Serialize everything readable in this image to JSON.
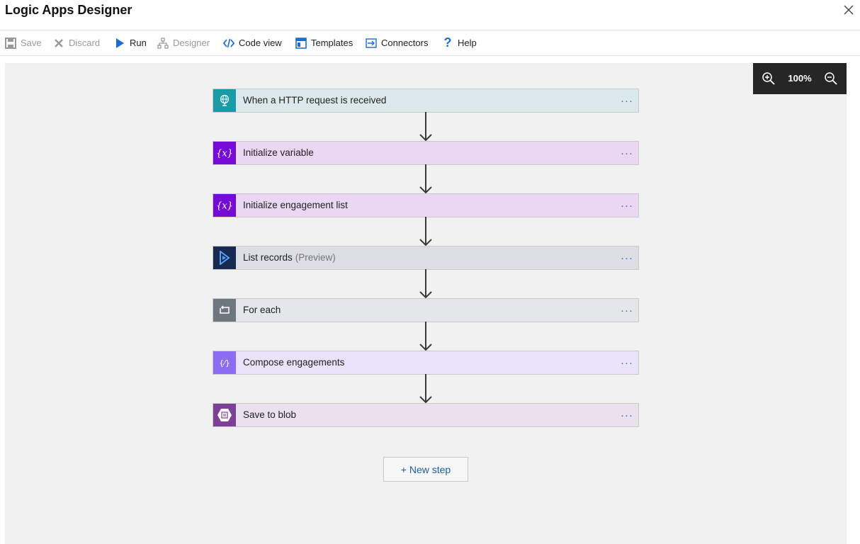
{
  "window": {
    "title": "Logic Apps Designer"
  },
  "toolbar": {
    "save": "Save",
    "discard": "Discard",
    "run": "Run",
    "designer": "Designer",
    "code_view": "Code view",
    "templates": "Templates",
    "connectors": "Connectors",
    "help": "Help"
  },
  "zoom": {
    "level": "100%"
  },
  "steps": [
    {
      "label": "When a HTTP request is received",
      "sub": "",
      "icon": "http-request-icon",
      "icon_color": "#1b9ba8",
      "bg": "#dbe9ec"
    },
    {
      "label": "Initialize variable",
      "sub": "",
      "icon": "variable-icon",
      "icon_color": "#770bd6",
      "bg": "#ead7f3"
    },
    {
      "label": "Initialize engagement list",
      "sub": "",
      "icon": "variable-icon",
      "icon_color": "#770bd6",
      "bg": "#ead7f3"
    },
    {
      "label": "List records",
      "sub": "(Preview)",
      "icon": "dynamics-icon",
      "icon_color": "#192a52",
      "bg": "#dcdee3"
    },
    {
      "label": "For each",
      "sub": "",
      "icon": "loop-icon",
      "icon_color": "#6e7680",
      "bg": "#e4e6e9"
    },
    {
      "label": "Compose engagements",
      "sub": "",
      "icon": "compose-icon",
      "icon_color": "#8c6cf0",
      "bg": "#ebe3fb"
    },
    {
      "label": "Save to blob",
      "sub": "",
      "icon": "blob-storage-icon",
      "icon_color": "#7d3f98",
      "bg": "#ebe0ee"
    }
  ],
  "more_glyph": "···",
  "new_step": "+ New step"
}
